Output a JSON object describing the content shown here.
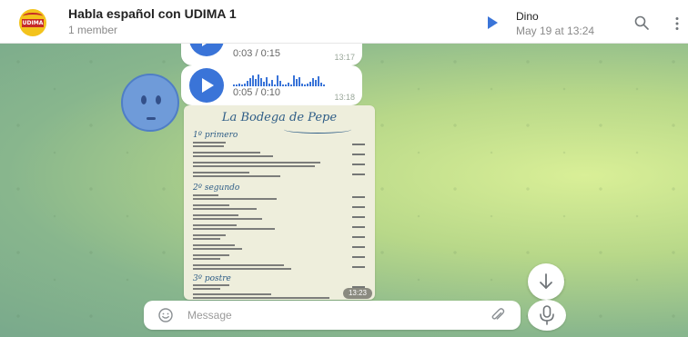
{
  "header": {
    "chat_title": "Habla español con UDIMA 1",
    "member_count": "1 member",
    "avatar_text": "UDIMA",
    "pinned": {
      "name": "Dino",
      "date": "May 19 at 13:24"
    }
  },
  "messages": [
    {
      "type": "voice",
      "duration": "0:03 / 0:15",
      "time": "13:17"
    },
    {
      "type": "voice",
      "duration": "0:05 / 0:10",
      "time": "13:18"
    },
    {
      "type": "image",
      "title": "La Bodega de Pepe",
      "sections": [
        "1º primero",
        "2º segundo",
        "3º postre"
      ],
      "time": "13:23"
    }
  ],
  "composer": {
    "placeholder": "Message"
  },
  "icons": {
    "pinned_play": "play-icon",
    "search": "search-icon",
    "more": "more-vertical-icon",
    "emoji": "smile-icon",
    "attach": "paperclip-icon",
    "mic": "microphone-icon",
    "scroll": "arrow-down-icon"
  },
  "colors": {
    "accent": "#3a74d8",
    "menu_ink": "#2d5c86"
  }
}
